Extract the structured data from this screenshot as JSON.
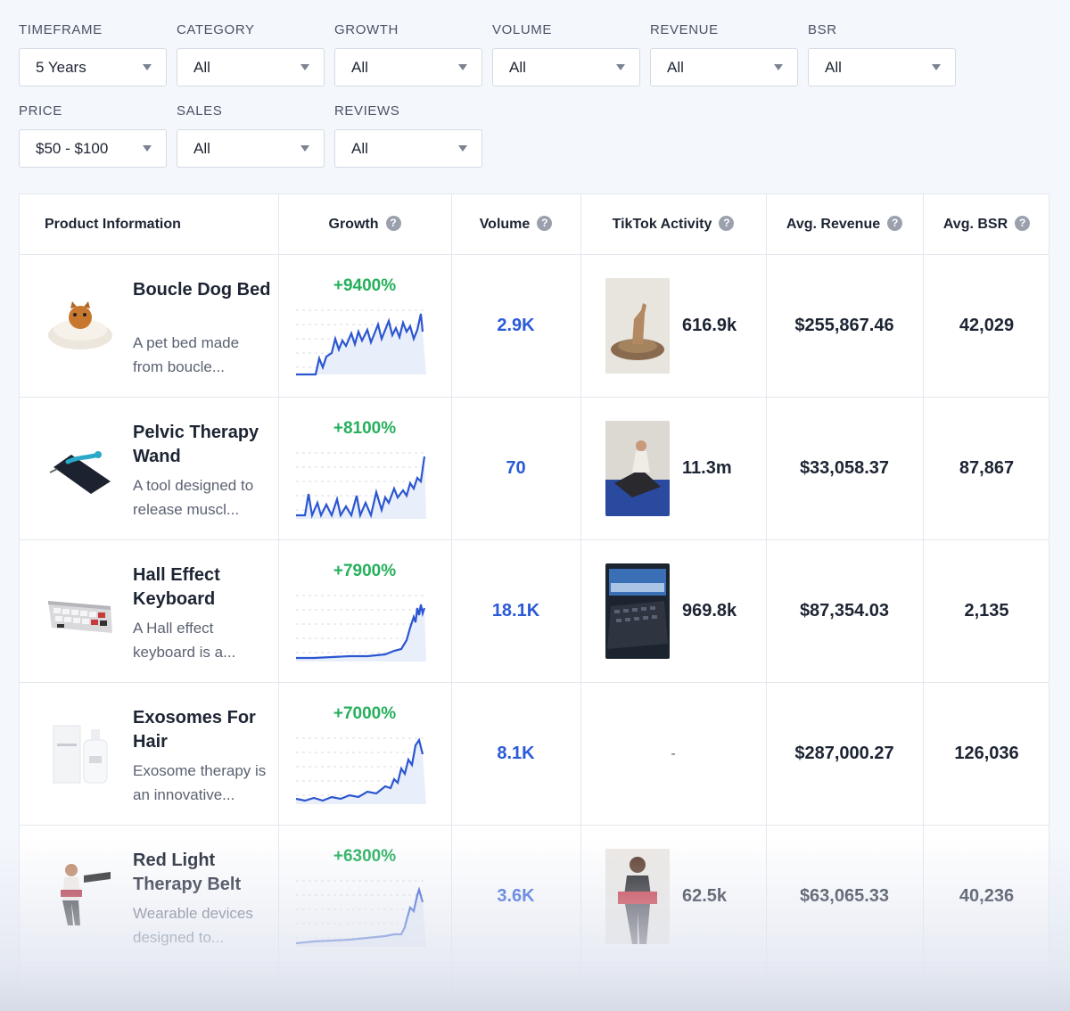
{
  "filters": [
    {
      "label": "TIMEFRAME",
      "value": "5 Years"
    },
    {
      "label": "CATEGORY",
      "value": "All"
    },
    {
      "label": "GROWTH",
      "value": "All"
    },
    {
      "label": "VOLUME",
      "value": "All"
    },
    {
      "label": "REVENUE",
      "value": "All"
    },
    {
      "label": "BSR",
      "value": "All"
    },
    {
      "label": "PRICE",
      "value": "$50 - $100"
    },
    {
      "label": "SALES",
      "value": "All"
    },
    {
      "label": "REVIEWS",
      "value": "All"
    }
  ],
  "table": {
    "headers": {
      "product": "Product Information",
      "growth": "Growth",
      "volume": "Volume",
      "tiktok": "TikTok Activity",
      "revenue": "Avg. Revenue",
      "bsr": "Avg. BSR",
      "help_icon": "?"
    },
    "rows": [
      {
        "name": "Boucle Dog Bed",
        "description": "A pet bed made from boucle...",
        "growth": "+9400%",
        "volume": "2.9K",
        "tiktok": "616.9k",
        "revenue": "$255,867.46",
        "bsr": "42,029",
        "icon": "dog-bed-image"
      },
      {
        "name": "Pelvic Therapy Wand",
        "description": "A tool designed to release muscl...",
        "growth": "+8100%",
        "volume": "70",
        "tiktok": "11.3m",
        "revenue": "$33,058.37",
        "bsr": "87,867",
        "icon": "therapy-wand-image"
      },
      {
        "name": "Hall Effect Keyboard",
        "description": "A Hall effect keyboard is a...",
        "growth": "+7900%",
        "volume": "18.1K",
        "tiktok": "969.8k",
        "revenue": "$87,354.03",
        "bsr": "2,135",
        "icon": "keyboard-image"
      },
      {
        "name": "Exosomes For Hair",
        "description": "Exosome therapy is an innovative...",
        "growth": "+7000%",
        "volume": "8.1K",
        "tiktok": "-",
        "revenue": "$287,000.27",
        "bsr": "126,036",
        "icon": "hair-product-image"
      },
      {
        "name": "Red Light Therapy Belt",
        "description": "Wearable devices designed to...",
        "growth": "+6300%",
        "volume": "3.6K",
        "tiktok": "62.5k",
        "revenue": "$63,065.33",
        "bsr": "40,236",
        "icon": "therapy-belt-image"
      }
    ]
  },
  "colors": {
    "growth": "#26b05c",
    "volume": "#2a5ad8",
    "spark_line": "#2b56d0"
  }
}
